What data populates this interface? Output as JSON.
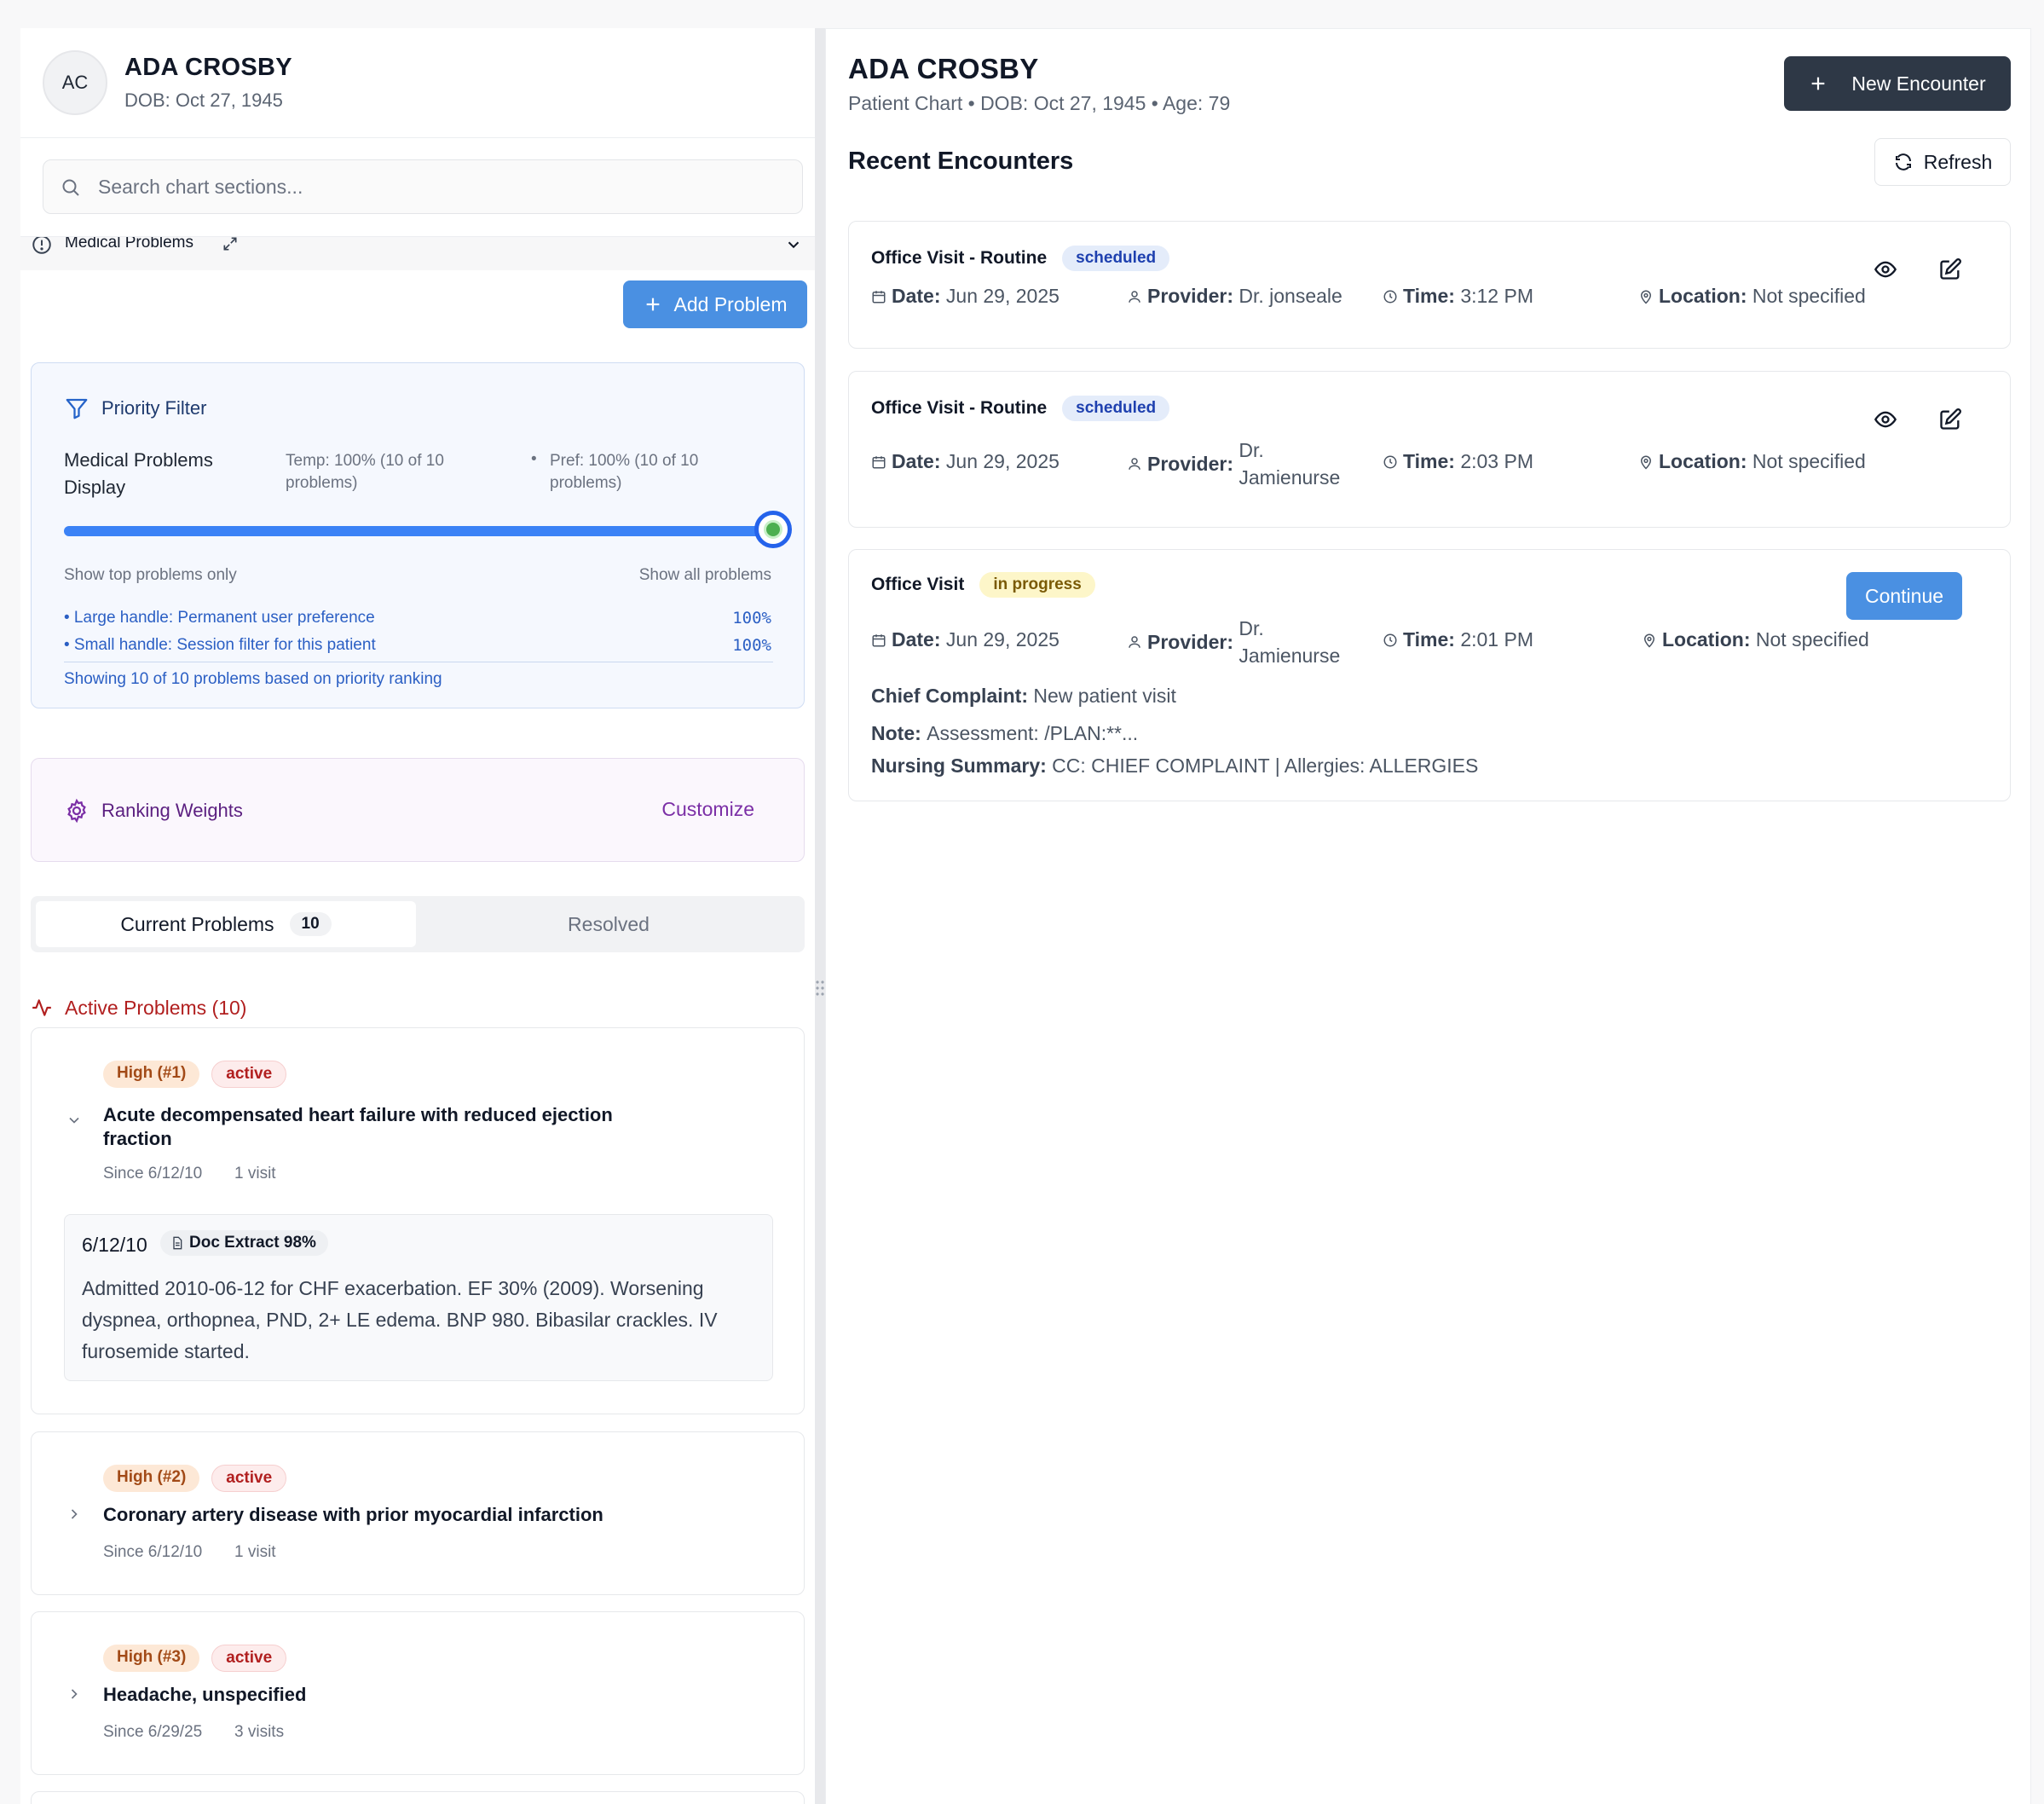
{
  "left": {
    "avatar_initials": "AC",
    "patient_name": "ADA CROSBY",
    "dob": "DOB: Oct 27, 1945",
    "search_placeholder": "Search chart sections...",
    "section_title": "Medical Problems",
    "add_problem_label": "Add Problem",
    "priority_filter": {
      "title": "Priority Filter",
      "display_label": "Medical Problems Display",
      "temp_text": "Temp: 100% (10 of 10 problems)",
      "pref_text": "Pref: 100% (10 of 10 problems)",
      "slider_value_percent": 100,
      "left_caption": "Show top problems only",
      "right_caption": "Show all problems",
      "large_handle_label": "• Large handle: Permanent user preference",
      "large_handle_value": "100%",
      "small_handle_label": "• Small handle: Session filter for this patient",
      "small_handle_value": "100%",
      "showing_text": "Showing 10 of 10 problems based on priority ranking"
    },
    "ranking": {
      "title": "Ranking Weights",
      "customize_label": "Customize"
    },
    "tabs": {
      "current_label": "Current Problems",
      "current_count": "10",
      "resolved_label": "Resolved"
    },
    "active_header": "Active Problems (10)",
    "problems": [
      {
        "priority": "High (#1)",
        "status": "active",
        "title": "Acute decompensated heart failure with reduced ejection fraction",
        "since": "Since 6/12/10",
        "visits": "1 visit",
        "expanded": true,
        "detail_date": "6/12/10",
        "detail_source": "Doc Extract 98%",
        "detail_text": "Admitted 2010-06-12 for CHF exacerbation. EF 30% (2009). Worsening dyspnea, orthopnea, PND, 2+ LE edema. BNP 980. Bibasilar crackles. IV furosemide started."
      },
      {
        "priority": "High (#2)",
        "status": "active",
        "title": "Coronary artery disease with prior myocardial infarction",
        "since": "Since 6/12/10",
        "visits": "1 visit"
      },
      {
        "priority": "High (#3)",
        "status": "active",
        "title": "Headache, unspecified",
        "since": "Since 6/29/25",
        "visits": "3 visits"
      }
    ]
  },
  "right": {
    "patient_name": "ADA CROSBY",
    "subtitle": "Patient Chart • DOB: Oct 27, 1945 • Age: 79",
    "new_encounter_label": "New Encounter",
    "recent_encounters_title": "Recent Encounters",
    "refresh_label": "Refresh",
    "encounters": [
      {
        "type": "Office Visit - Routine",
        "status": "scheduled",
        "date_label": "Date:",
        "date": "Jun 29, 2025",
        "provider_label": "Provider:",
        "provider": "Dr. jonseale",
        "time_label": "Time:",
        "time": "3:12 PM",
        "location_label": "Location:",
        "location": "Not specified"
      },
      {
        "type": "Office Visit - Routine",
        "status": "scheduled",
        "date_label": "Date:",
        "date": "Jun 29, 2025",
        "provider_label": "Provider:",
        "provider": "Dr. Jamienurse",
        "time_label": "Time:",
        "time": "2:03 PM",
        "location_label": "Location:",
        "location": "Not specified"
      },
      {
        "type": "Office Visit",
        "status": "in progress",
        "continue_label": "Continue",
        "date_label": "Date:",
        "date": "Jun 29, 2025",
        "provider_label": "Provider:",
        "provider": "Dr. Jamienurse",
        "time_label": "Time:",
        "time": "2:01 PM",
        "location_label": "Location:",
        "location": "Not specified",
        "cc_label": "Chief Complaint:",
        "cc": "New patient visit",
        "note_label": "Note:",
        "note": "Assessment: /PLAN:**...",
        "nursing_label": "Nursing Summary:",
        "nursing": "CC: CHIEF COMPLAINT | Allergies: ALLERGIES"
      }
    ]
  },
  "colors": {
    "accent_blue": "#4a90e2",
    "dark_button": "#2e3846",
    "danger_red": "#b11f1f",
    "purple": "#7b2fa6",
    "scheduled_badge": "#e4ecfa",
    "in_progress_badge": "#fdf6c9"
  }
}
